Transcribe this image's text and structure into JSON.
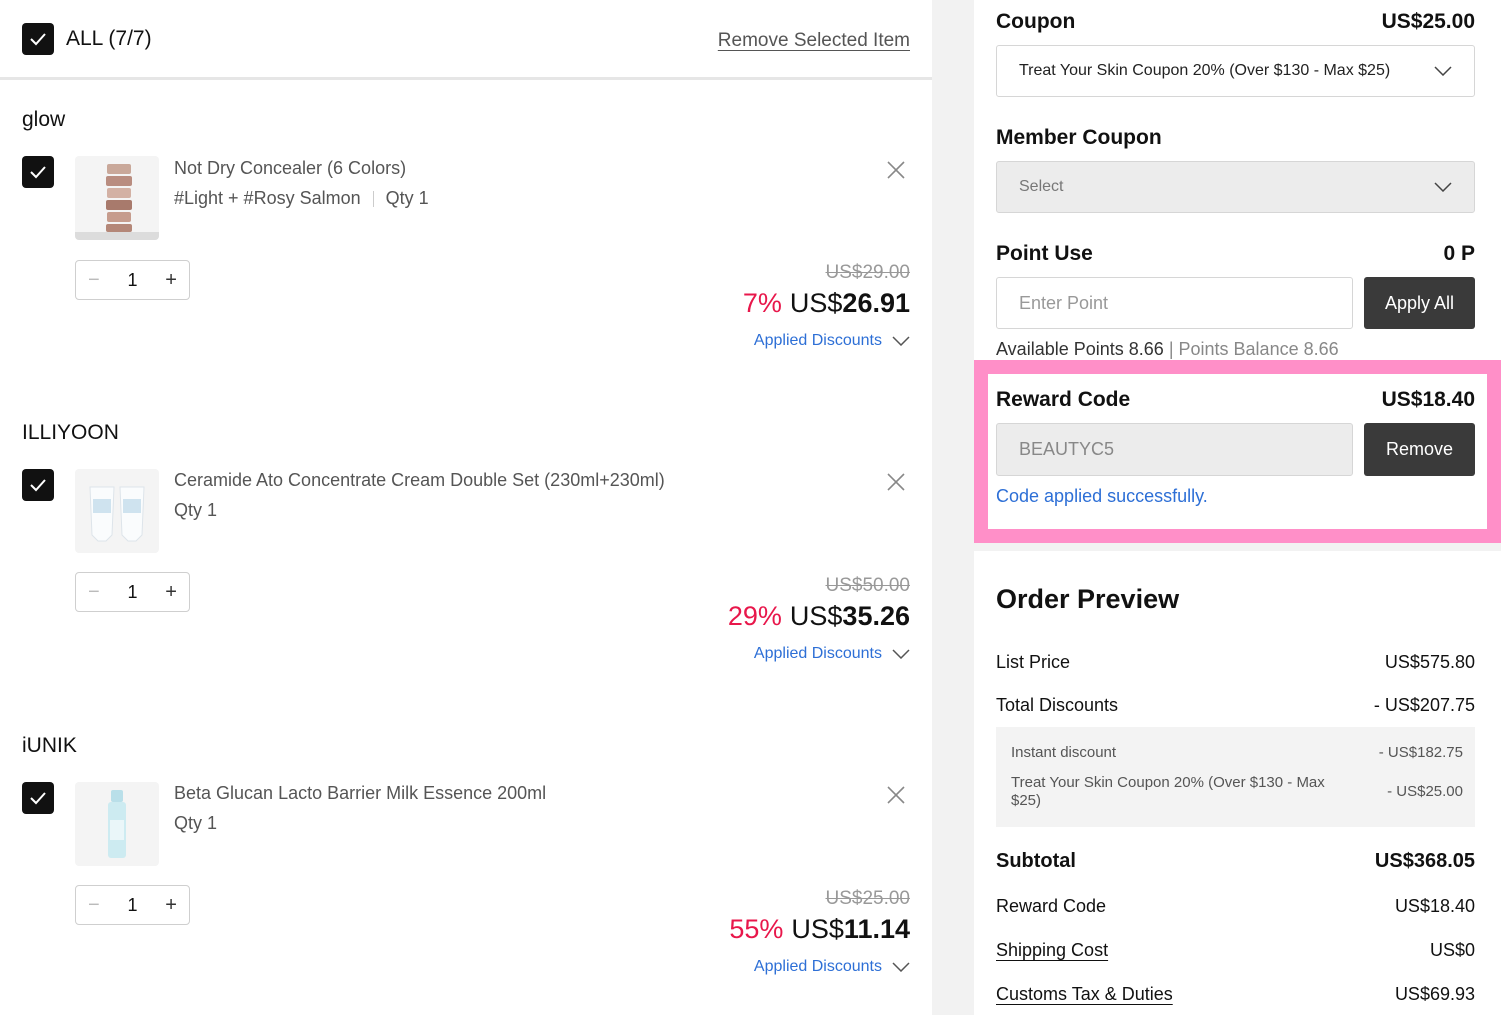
{
  "cart": {
    "all_label": "ALL (7/7)",
    "remove_selected": "Remove Selected Item",
    "items": [
      {
        "brand": "glow",
        "name": "Not Dry Concealer (6 Colors)",
        "option": "#Light + #Rosy Salmon",
        "qty_label": "Qty 1",
        "qty": "1",
        "original_price": "US$29.00",
        "discount_pct": "7%",
        "currency": "US$",
        "price": "26.91",
        "applied_discounts": "Applied Discounts",
        "checked": true
      },
      {
        "brand": "ILLIYOON",
        "name": "Ceramide Ato Concentrate Cream Double Set (230ml+230ml)",
        "option": "",
        "qty_label": "Qty 1",
        "qty": "1",
        "original_price": "US$50.00",
        "discount_pct": "29%",
        "currency": "US$",
        "price": "35.26",
        "applied_discounts": "Applied Discounts",
        "checked": true
      },
      {
        "brand": "iUNIK",
        "name": "Beta Glucan Lacto Barrier Milk Essence 200ml",
        "option": "",
        "qty_label": "Qty 1",
        "qty": "1",
        "original_price": "US$25.00",
        "discount_pct": "55%",
        "currency": "US$",
        "price": "11.14",
        "applied_discounts": "Applied Discounts",
        "checked": true
      }
    ],
    "stepper": {
      "minus": "−",
      "plus": "+"
    }
  },
  "coupon": {
    "label": "Coupon",
    "amount": "US$25.00",
    "selected": "Treat Your Skin Coupon 20% (Over $130 - Max $25)"
  },
  "member_coupon": {
    "label": "Member Coupon",
    "placeholder": "Select"
  },
  "point_use": {
    "label": "Point Use",
    "value": "0 P",
    "placeholder": "Enter Point",
    "apply_all": "Apply All",
    "available": "Available Points 8.66",
    "separator": "|",
    "balance": "Points Balance 8.66"
  },
  "reward_code": {
    "label": "Reward Code",
    "amount": "US$18.40",
    "code": "BEAUTYC5",
    "remove": "Remove",
    "message": "Code applied successfully."
  },
  "order_preview": {
    "title": "Order Preview",
    "list_price_label": "List Price",
    "list_price": "US$575.80",
    "total_discounts_label": "Total Discounts",
    "total_discounts": "- US$207.75",
    "instant_discount_label": "Instant discount",
    "instant_discount": "- US$182.75",
    "coupon_discount_label_1": "Treat Your Skin Coupon 20% (Over $130 - Max",
    "coupon_discount_label_2": "$25)",
    "coupon_discount": "- US$25.00",
    "subtotal_label": "Subtotal",
    "subtotal": "US$368.05",
    "reward_code_label": "Reward Code",
    "reward_code": "US$18.40",
    "shipping_label": "Shipping Cost",
    "shipping": "US$0",
    "customs_label": "Customs Tax & Duties",
    "customs": "US$69.93"
  },
  "colors": {
    "discount_red": "#e8174b",
    "link_blue": "#2d6fd6",
    "highlight_pink": "#ff8fc8",
    "dark_button": "#3a3a3a"
  }
}
